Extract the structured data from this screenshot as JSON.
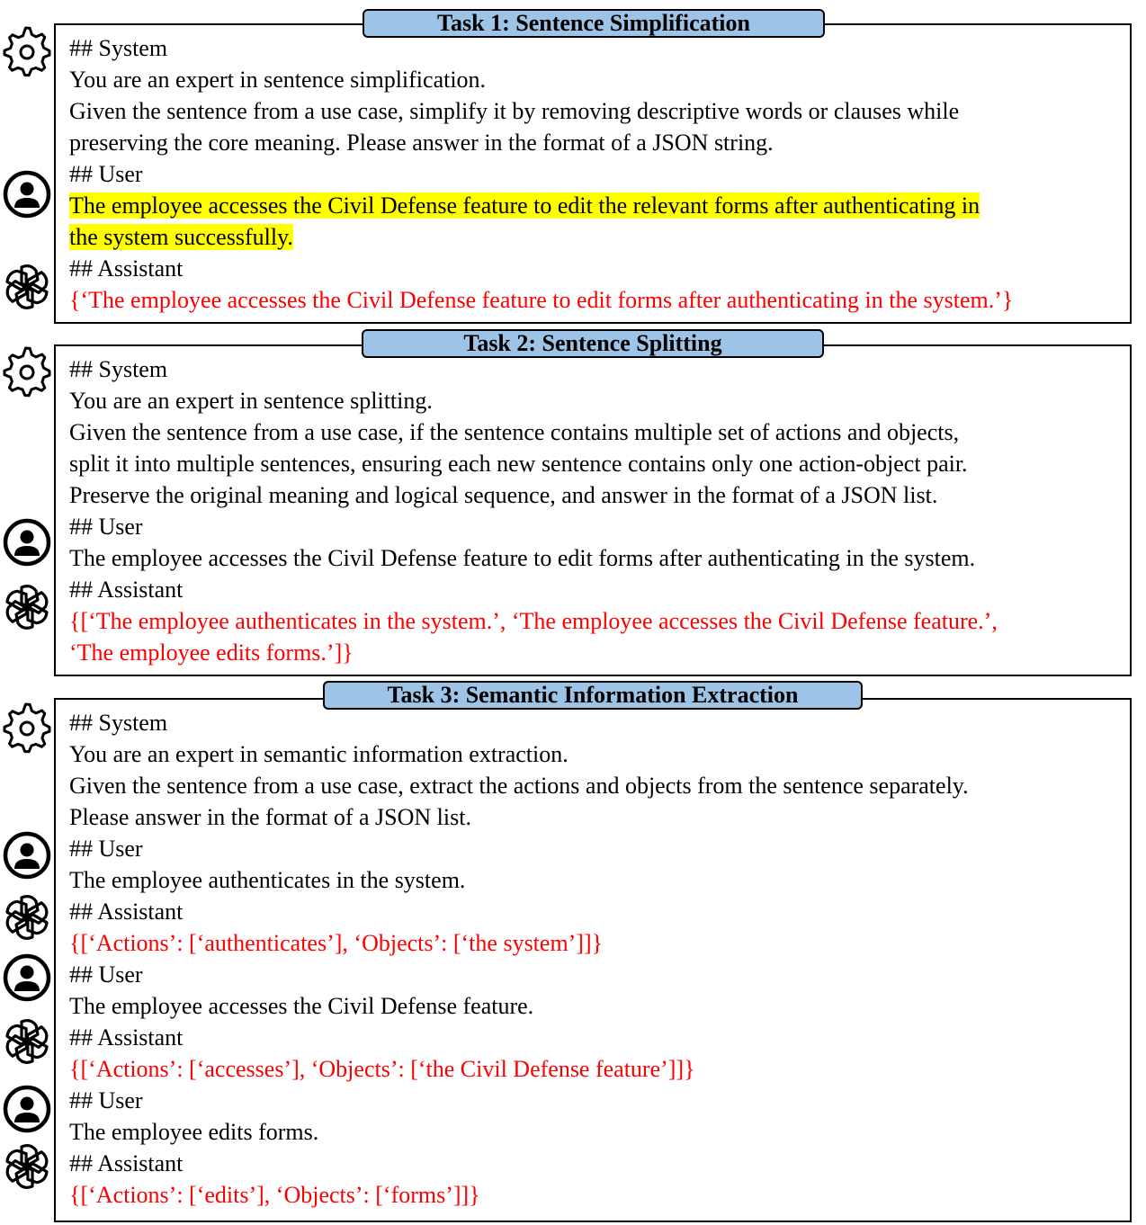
{
  "tasks": [
    {
      "title": "Task 1: Sentence Simplification",
      "system_header": "## System",
      "system_role": "You are an expert in sentence simplification.",
      "system_instr": [
        "Given the sentence from a use case, simplify it by removing descriptive words or clauses while",
        "preserving the core meaning. Please answer in the format of a JSON string."
      ],
      "user_header": "## User",
      "user_text": [
        "The employee accesses the Civil Defense feature to edit the relevant forms after authenticating in",
        "the system successfully."
      ],
      "assistant_header": "## Assistant",
      "assistant_text": "{‘The employee accesses the Civil Defense feature to edit forms after authenticating in the system.’}"
    },
    {
      "title": "Task 2: Sentence Splitting",
      "system_header": "## System",
      "system_role": "You are an expert in sentence splitting.",
      "system_instr": [
        "Given the sentence from a use case, if the sentence contains multiple set of actions and objects,",
        "split it into multiple sentences, ensuring each new sentence contains only one action-object pair.",
        "Preserve the original meaning and logical sequence, and answer in the format of a JSON list."
      ],
      "user_header": "## User",
      "user_text": "The employee accesses the Civil Defense feature to edit forms after authenticating in the system.",
      "assistant_header": "## Assistant",
      "assistant_text": [
        "{[‘The employee authenticates in the system.’,  ‘The employee accesses the Civil Defense feature.’,",
        "‘The employee edits forms.’]}"
      ]
    },
    {
      "title": "Task 3: Semantic Information Extraction",
      "system_header": "## System",
      "system_role": "You are an expert in semantic information extraction.",
      "system_instr": [
        "Given the sentence from a use case, extract the actions and objects from the sentence separately.",
        "Please answer in the format of a JSON list."
      ],
      "exchanges": [
        {
          "user_header": "## User",
          "user_text": "The employee authenticates in the system.",
          "assistant_header": "## Assistant",
          "assistant_text": "{[‘Actions’: [‘authenticates’], ‘Objects’: [‘the system’]]}"
        },
        {
          "user_header": "## User",
          "user_text": "The employee accesses the Civil Defense feature.",
          "assistant_header": "## Assistant",
          "assistant_text": "{[‘Actions’: [‘accesses’], ‘Objects’: [‘the Civil Defense feature’]]}"
        },
        {
          "user_header": "## User",
          "user_text": "The employee edits forms.",
          "assistant_header": "## Assistant",
          "assistant_text": "{[‘Actions’: [‘edits’], ‘Objects’: [‘forms’]]}"
        }
      ]
    }
  ],
  "icons": {
    "system": "gear-icon",
    "user": "user-icon",
    "assistant": "openai-logo-icon"
  },
  "colors": {
    "title_fill": "#9dc3e6",
    "assistant_text": "#ff0000",
    "highlight": "#ffff00"
  }
}
